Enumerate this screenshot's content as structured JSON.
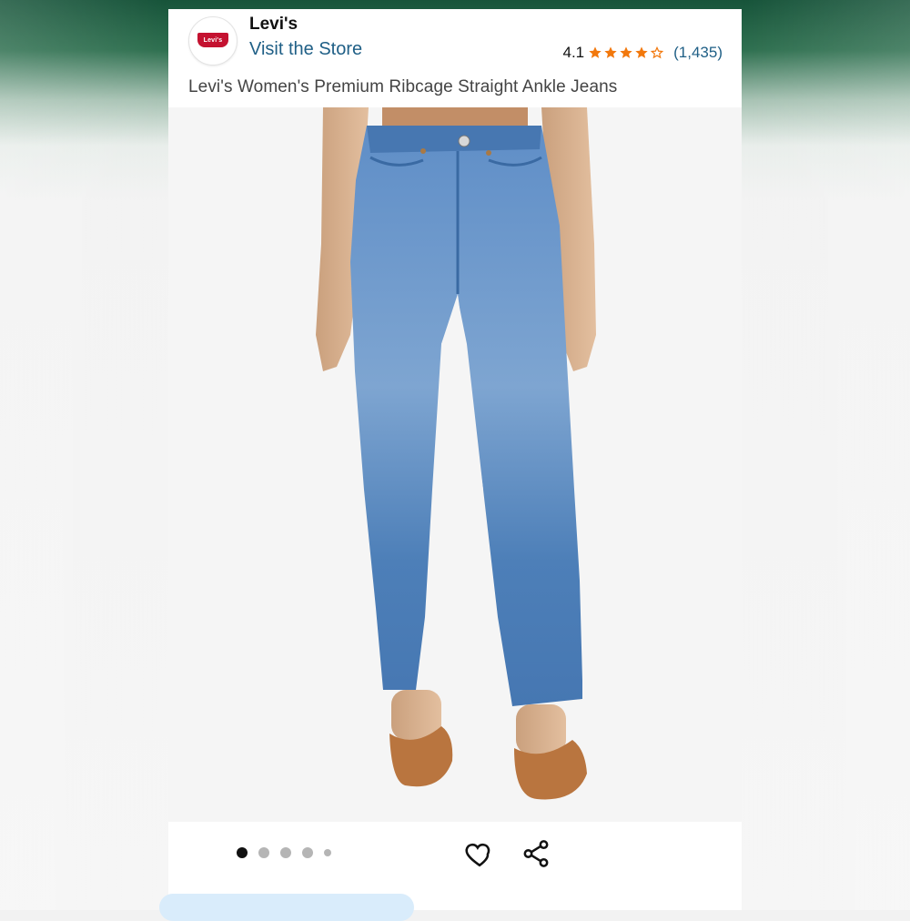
{
  "header": {
    "brand_name": "Levi's",
    "logo_text": "Levi's",
    "store_link": "Visit the Store",
    "rating_value": "4.1",
    "rating_stars": 4.1,
    "rating_count": "(1,435)",
    "product_title": "Levi's Women's Premium Ribcage Straight Ankle Jeans"
  },
  "gallery": {
    "image_count": 5,
    "active_index": 0
  },
  "colors": {
    "star": "#f2780c",
    "link": "#1f5f86",
    "logo_red": "#c41230",
    "denim": "#5b86b9"
  },
  "icons": [
    "heart-icon",
    "share-icon"
  ]
}
